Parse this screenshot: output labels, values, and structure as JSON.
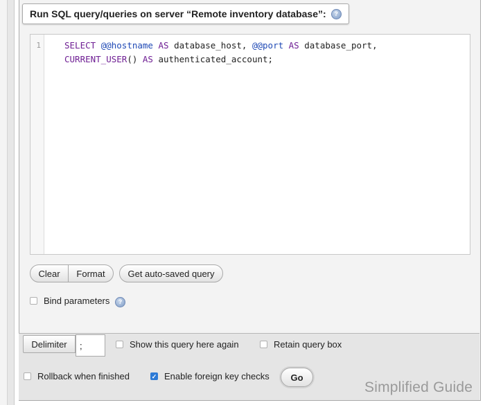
{
  "query_box": {
    "title": "Run SQL query/queries on server “Remote inventory database”:",
    "help_icon": "question-circle-icon"
  },
  "editor": {
    "line_number": "1",
    "code": {
      "kw_select": "SELECT",
      "var_hostname": "@@hostname",
      "kw_as1": "AS",
      "alias1": "database_host,",
      "var_port": "@@port",
      "kw_as2": "AS",
      "alias2": "database_port,",
      "fn_current_user": "CURRENT_USER",
      "parens": "()",
      "kw_as3": "AS",
      "alias3": "authenticated_account;"
    }
  },
  "buttons": {
    "clear": "Clear",
    "format": "Format",
    "auto_saved": "Get auto-saved query",
    "go": "Go"
  },
  "options": {
    "bind_parameters": {
      "label": "Bind parameters",
      "checked": false
    },
    "show_query_again": {
      "label": "Show this query here again",
      "checked": false
    },
    "retain_query_box": {
      "label": "Retain query box",
      "checked": false
    },
    "rollback": {
      "label": "Rollback when finished",
      "checked": false
    },
    "foreign_key_checks": {
      "label": "Enable foreign key checks",
      "checked": true
    }
  },
  "delimiter": {
    "label": "Delimiter",
    "value": ";"
  },
  "watermark": "Simplified Guide",
  "colors": {
    "keyword": "#6f1f94",
    "variable": "#1f49b5",
    "checkbox_checked": "#2d7ad6"
  }
}
